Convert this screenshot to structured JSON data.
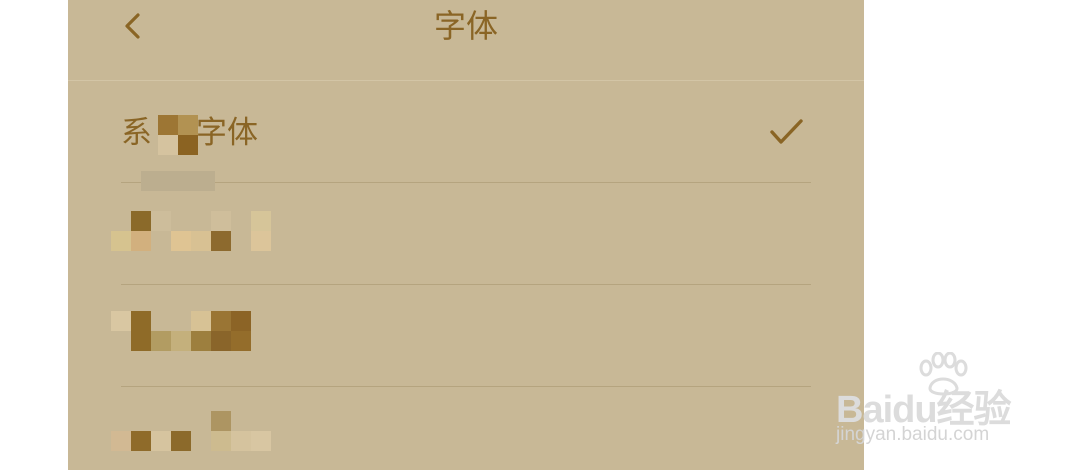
{
  "header": {
    "title": "字体",
    "back_icon": "chevron-left-icon"
  },
  "fonts": [
    {
      "label_prefix": "系",
      "label_suffix": "字体",
      "selected": true
    },
    {
      "label_prefix": "",
      "label_suffix": "",
      "selected": false
    },
    {
      "label_prefix": "",
      "label_suffix": "",
      "selected": false
    },
    {
      "label_prefix": "",
      "label_suffix": "",
      "selected": false
    }
  ],
  "check_icon": "checkmark-icon",
  "watermark": {
    "logo": "Baidu经验",
    "url": "jingyan.baidu.com"
  },
  "colors": {
    "background": "#c8b896",
    "accent": "#8a6525",
    "divider": "#b5a47f"
  }
}
